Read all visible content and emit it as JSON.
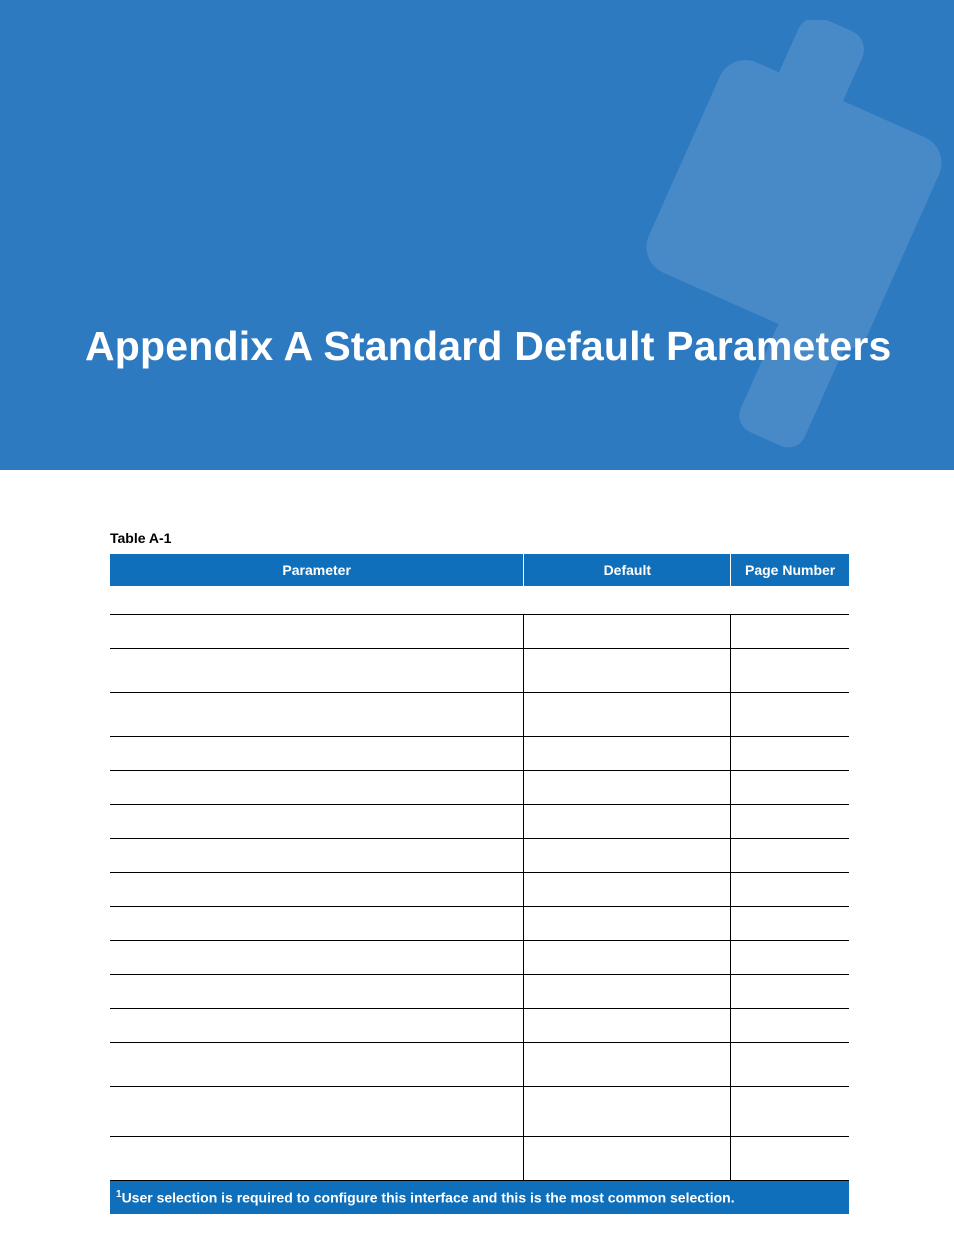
{
  "banner": {
    "title": "Appendix A Standard Default Parameters"
  },
  "table": {
    "caption": "Table A-1",
    "headers": {
      "parameter": "Parameter",
      "default": "Default",
      "page_number": "Page Number"
    },
    "rows": [
      {
        "parameter": "",
        "default": "",
        "page": ""
      },
      {
        "parameter": "",
        "default": "",
        "page": ""
      },
      {
        "parameter": "",
        "default": "",
        "page": ""
      },
      {
        "parameter": "",
        "default": "",
        "page": ""
      },
      {
        "parameter": "",
        "default": "",
        "page": ""
      },
      {
        "parameter": "",
        "default": "",
        "page": ""
      },
      {
        "parameter": "",
        "default": "",
        "page": ""
      },
      {
        "parameter": "",
        "default": "",
        "page": ""
      },
      {
        "parameter": "",
        "default": "",
        "page": ""
      },
      {
        "parameter": "",
        "default": "",
        "page": ""
      },
      {
        "parameter": "",
        "default": "",
        "page": ""
      },
      {
        "parameter": "",
        "default": "",
        "page": ""
      },
      {
        "parameter": "",
        "default": "",
        "page": ""
      },
      {
        "parameter": "",
        "default": "",
        "page": ""
      },
      {
        "parameter": "",
        "default": "",
        "page": ""
      }
    ],
    "footnote_sup": "1",
    "footnote": "User selection is required to configure this interface and this is the most common selection."
  }
}
